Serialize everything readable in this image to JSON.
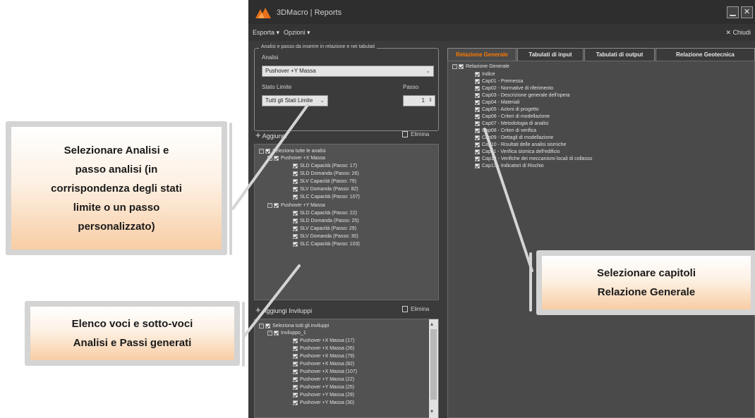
{
  "window": {
    "title": "3DMacro | Reports",
    "minimize": "▁",
    "close": "✕"
  },
  "menu": {
    "export": "Esporta ▾",
    "options": "Opzioni ▾",
    "close": "✕ Chiudi"
  },
  "analysis_group": {
    "legend": "Analisi e passo da inserire in relazione e nei tabulati",
    "analysis_label": "Analisi",
    "analysis_value": "Pushover +Y Massa",
    "limit_state_label": "Stato Limite",
    "limit_state_value": "Tutti gli Stati Limite",
    "step_label": "Passo",
    "step_value": "1"
  },
  "add_label": "Aggiungi",
  "delete_label": "Elimina",
  "analysis_tree": {
    "root": "Seleziona tutte le analisi",
    "groups": [
      {
        "name": "Pushover +X Massa",
        "items": [
          "SLD Capacità (Passo: 17)",
          "SLD Domanda (Passo: 26)",
          "SLV Capacità (Passo: 79)",
          "SLV Domanda (Passo: 82)",
          "SLC Capacità (Passo: 107)"
        ]
      },
      {
        "name": "Pushover +Y Massa",
        "items": [
          "SLD Capacità (Passo: 22)",
          "SLD Domanda (Passo: 25)",
          "SLV Capacità (Passo: 29)",
          "SLV Domanda (Passo: 30)",
          "SLC Capacità (Passo: 103)"
        ]
      }
    ]
  },
  "envelopes": {
    "add_label": "Aggiungi Inviluppi",
    "delete_label": "Elimina",
    "root": "Seleziona tutti gli inviluppi",
    "group": "Inviluppo_1",
    "items": [
      "Pushover +X Massa (17)",
      "Pushover +X Massa (26)",
      "Pushover +X Massa (79)",
      "Pushover +X Massa (82)",
      "Pushover +X Massa (107)",
      "Pushover +Y Massa (22)",
      "Pushover +Y Massa (25)",
      "Pushover +Y Massa (29)",
      "Pushover +Y Massa (30)"
    ]
  },
  "tabs": [
    "Relazione Generale",
    "Tabulati di input",
    "Tabulati di output",
    "Relazione Geotecnica"
  ],
  "report_tree": {
    "root": "Relazione Generale",
    "chapters": [
      "Indice",
      "Cap01 - Premessa",
      "Cap02 - Normative di riferimento",
      "Cap03 - Descrizione generale dell'opera",
      "Cap04 - Materiali",
      "Cap05 - Azioni di progetto",
      "Cap06 - Criteri di modellazione",
      "Cap07 - Metodologia di analisi",
      "Cap08 - Criteri di verifica",
      "Cap09 - Dettagli di modellazione",
      "Cap10 - Risultati delle analisi sismiche",
      "Cap11 - Verifica sismica dell'edificio",
      "Cap12 - Verifiche dei meccanismi locali di collasso",
      "Cap13 - Indicatori di Rischio"
    ]
  },
  "callouts": {
    "left_top": "Selezionare Analisi e\npasso analisi (in\ncorrispondenza degli stati\nlimite o un passo\npersonalizzato)",
    "left_bottom": "Elenco voci e sotto-voci\nAnalisi e Passi generati",
    "right": "Selezionare capitoli\nRelazione Generale"
  },
  "colors": {
    "accent": "#ff7a00",
    "window_bg": "#3b3b3b",
    "callout_border": "#d4d4d4"
  }
}
